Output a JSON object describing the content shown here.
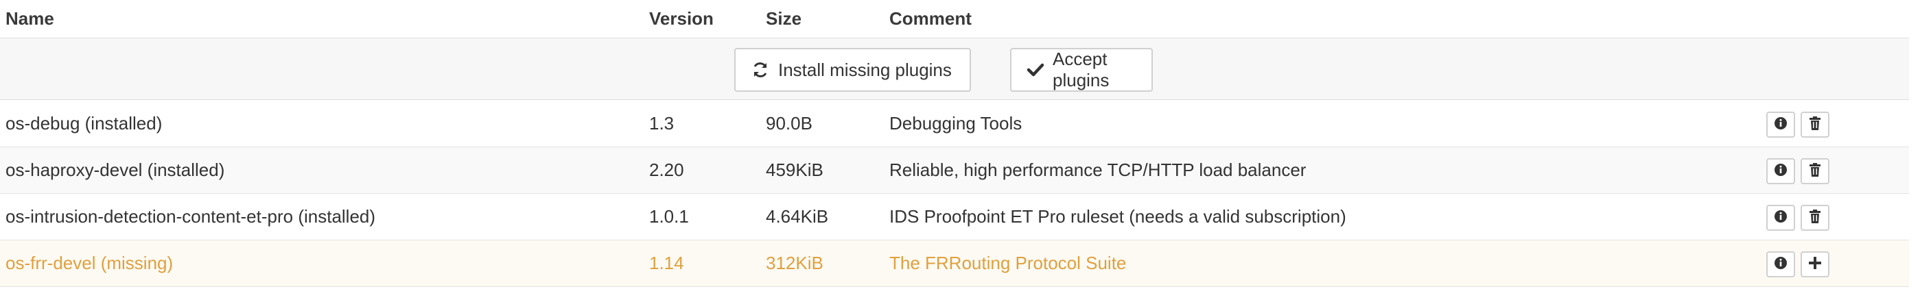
{
  "table": {
    "headers": {
      "name": "Name",
      "version": "Version",
      "size": "Size",
      "comment": "Comment"
    },
    "actions": {
      "install_missing_label": "Install missing plugins",
      "install_missing_icon": "refresh-icon",
      "accept_label": "Accept plugins",
      "accept_icon": "check-icon"
    },
    "rows": [
      {
        "name": "os-debug (installed)",
        "version": "1.3",
        "size": "90.0B",
        "comment": "Debugging Tools",
        "action_icon": "trash-icon",
        "status": "installed"
      },
      {
        "name": "os-haproxy-devel (installed)",
        "version": "2.20",
        "size": "459KiB",
        "comment": "Reliable, high performance TCP/HTTP load balancer",
        "action_icon": "trash-icon",
        "status": "installed"
      },
      {
        "name": "os-intrusion-detection-content-et-pro (installed)",
        "version": "1.0.1",
        "size": "4.64KiB",
        "comment": "IDS Proofpoint ET Pro ruleset (needs a valid subscription)",
        "action_icon": "trash-icon",
        "status": "installed"
      },
      {
        "name": "os-frr-devel (missing)",
        "version": "1.14",
        "size": "312KiB",
        "comment": "The FRRouting Protocol Suite",
        "action_icon": "plus-icon",
        "status": "missing"
      }
    ]
  },
  "colors": {
    "missing_text": "#e0a03e",
    "border": "#dddddd",
    "row_alt": "#f9f9f9"
  }
}
